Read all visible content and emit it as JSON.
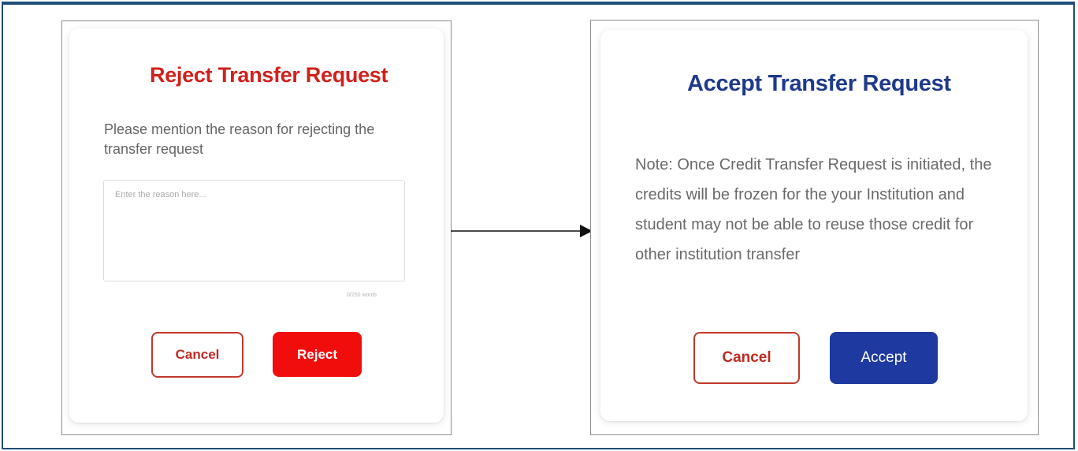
{
  "reject_dialog": {
    "title": "Reject Transfer Request",
    "prompt": "Please mention the reason for rejecting the transfer request",
    "reason_placeholder": "Enter the reason here...",
    "word_count": "0/250 words",
    "cancel_label": "Cancel",
    "reject_label": "Reject"
  },
  "accept_dialog": {
    "title": "Accept Transfer Request",
    "note": "Note: Once Credit Transfer Request is initiated, the credits will be frozen for the your Institution and student may not be able to reuse those credit for other institution transfer",
    "cancel_label": "Cancel",
    "accept_label": "Accept"
  },
  "colors": {
    "reject_title": "#d2201b",
    "reject_button": "#f20d0d",
    "accept_title": "#1e3a8a",
    "accept_button": "#1e3aa0",
    "cancel_border": "#c0392b",
    "frame_border": "#1f4e79"
  },
  "icons": {
    "flow_arrow": "arrow-right-icon"
  }
}
